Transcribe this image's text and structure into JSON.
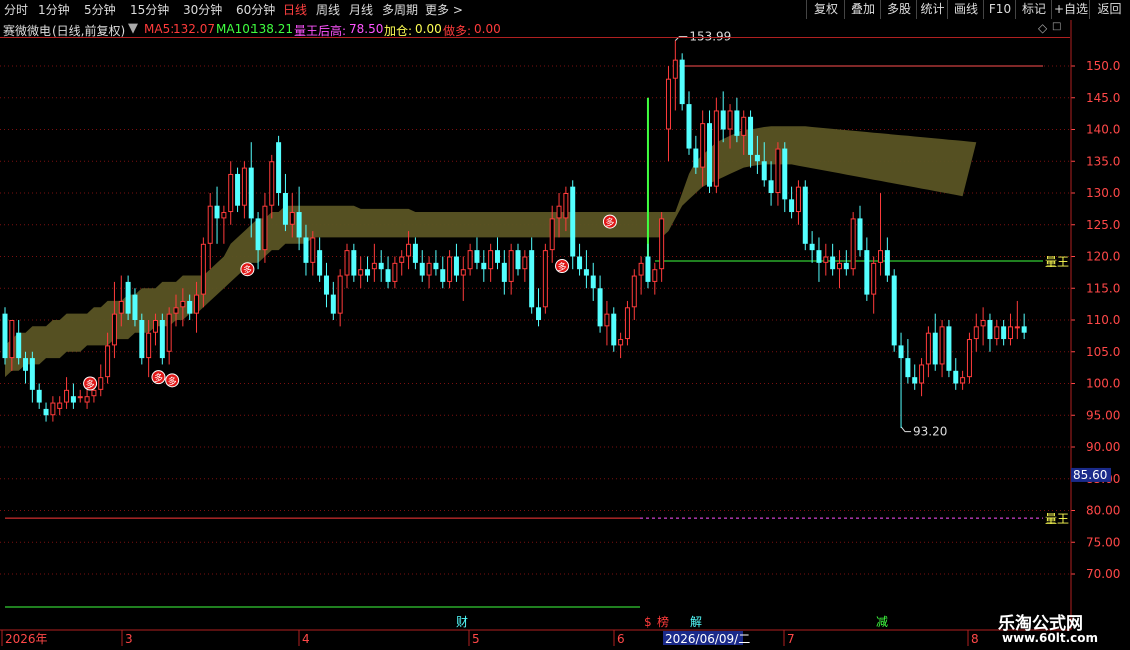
{
  "toolbar": {
    "periods": [
      "分时",
      "1分钟",
      "5分钟",
      "15分钟",
      "30分钟",
      "60分钟",
      "日线",
      "周线",
      "月线",
      "多周期",
      "更多 >"
    ],
    "active_period": "日线",
    "right_buttons": [
      "复权",
      "叠加",
      "多股",
      "统计",
      "画线",
      "F10",
      "标记",
      "+自选",
      "返回"
    ]
  },
  "info": {
    "stock_name": "赛微微电",
    "mode": "(日线,前复权)",
    "ma5_label": "MA5:",
    "ma5_value": "132.07",
    "ma10_label": "MA10:",
    "ma10_value": "138.21",
    "king_label": "量王后高:",
    "king_value": "78.50",
    "addpos_label": "加仓:",
    "addpos_value": "0.00",
    "short_label": "做多:",
    "short_value": "0.00"
  },
  "colors": {
    "up": "#ff3b3b",
    "down": "#54ffff",
    "band": "#5a5424",
    "grid": "#7a1010",
    "axis_text": "#ff4848",
    "yellow": "#ffff54",
    "magenta": "#ff54ff",
    "green": "#40ff40"
  },
  "price_axis": {
    "ticks": [
      150,
      145,
      140,
      135,
      130,
      125,
      120,
      115,
      110,
      105,
      100,
      95,
      90,
      85,
      80,
      75,
      70
    ],
    "tick_labels": [
      "150.0",
      "145.0",
      "140.0",
      "135.0",
      "130.0",
      "125.0",
      "120.0",
      "115.0",
      "110.0",
      "105.0",
      "100.0",
      "95.00",
      "90.00",
      "85.00",
      "80.00",
      "75.00",
      "70.00"
    ],
    "current_price_label": "85.60",
    "current_price": 85.6
  },
  "annotations": {
    "high_label": "153.99",
    "high_value": 153.99,
    "low_label": "93.20",
    "low_value": 93.2,
    "king_line_label_1": "量王",
    "king_line_value_1": 119.3,
    "king_line_label_2": "量王",
    "king_line_value_2": 78.8,
    "signal_label": "多"
  },
  "bottom_markers": [
    "财",
    "$",
    "榜",
    "解",
    "减"
  ],
  "date_axis": {
    "labels": [
      "2026年",
      "3",
      "4",
      "5",
      "6",
      "7",
      "8"
    ],
    "cursor_date": "2026/06/09/二"
  },
  "watermark": {
    "title": "乐淘公式网",
    "url": "www.60lt.com"
  },
  "chart_data": {
    "type": "candlestick",
    "ylim": [
      67,
      156
    ],
    "candles": [
      {
        "o": 111,
        "h": 112,
        "l": 103,
        "c": 104
      },
      {
        "o": 104,
        "h": 110,
        "l": 102,
        "c": 110
      },
      {
        "o": 108,
        "h": 110,
        "l": 103,
        "c": 104
      },
      {
        "o": 104,
        "h": 105,
        "l": 100,
        "c": 102
      },
      {
        "o": 104,
        "h": 105,
        "l": 97,
        "c": 99
      },
      {
        "o": 99,
        "h": 100,
        "l": 96,
        "c": 97
      },
      {
        "o": 96,
        "h": 97,
        "l": 94,
        "c": 95
      },
      {
        "o": 95,
        "h": 98,
        "l": 94,
        "c": 97
      },
      {
        "o": 96,
        "h": 98,
        "l": 95,
        "c": 97
      },
      {
        "o": 97,
        "h": 101,
        "l": 96,
        "c": 99
      },
      {
        "o": 98,
        "h": 100,
        "l": 96,
        "c": 97
      },
      {
        "o": 98,
        "h": 99,
        "l": 97,
        "c": 98
      },
      {
        "o": 97,
        "h": 99,
        "l": 96,
        "c": 98
      },
      {
        "o": 98,
        "h": 101,
        "l": 97,
        "c": 99
      },
      {
        "o": 99,
        "h": 103,
        "l": 98,
        "c": 101
      },
      {
        "o": 101,
        "h": 108,
        "l": 100,
        "c": 106
      },
      {
        "o": 106,
        "h": 116,
        "l": 104,
        "c": 111
      },
      {
        "o": 111,
        "h": 117,
        "l": 109,
        "c": 113
      },
      {
        "o": 116,
        "h": 117,
        "l": 110,
        "c": 111
      },
      {
        "o": 114,
        "h": 115,
        "l": 109,
        "c": 110
      },
      {
        "o": 110,
        "h": 111,
        "l": 103,
        "c": 104
      },
      {
        "o": 104,
        "h": 110,
        "l": 101,
        "c": 108
      },
      {
        "o": 108,
        "h": 111,
        "l": 106,
        "c": 110
      },
      {
        "o": 110,
        "h": 111,
        "l": 103,
        "c": 104
      },
      {
        "o": 105,
        "h": 112,
        "l": 103,
        "c": 111
      },
      {
        "o": 111,
        "h": 114,
        "l": 109,
        "c": 112
      },
      {
        "o": 112,
        "h": 115,
        "l": 109,
        "c": 113
      },
      {
        "o": 113,
        "h": 114,
        "l": 110,
        "c": 111
      },
      {
        "o": 111,
        "h": 116,
        "l": 108,
        "c": 114
      },
      {
        "o": 114,
        "h": 123,
        "l": 112,
        "c": 122
      },
      {
        "o": 122,
        "h": 130,
        "l": 118,
        "c": 128
      },
      {
        "o": 128,
        "h": 131,
        "l": 122,
        "c": 126
      },
      {
        "o": 126,
        "h": 128,
        "l": 122,
        "c": 127
      },
      {
        "o": 127,
        "h": 135,
        "l": 125,
        "c": 133
      },
      {
        "o": 133,
        "h": 134,
        "l": 127,
        "c": 128
      },
      {
        "o": 128,
        "h": 135,
        "l": 126,
        "c": 134
      },
      {
        "o": 134,
        "h": 138,
        "l": 123,
        "c": 126
      },
      {
        "o": 126,
        "h": 127,
        "l": 118,
        "c": 121
      },
      {
        "o": 121,
        "h": 130,
        "l": 119,
        "c": 128
      },
      {
        "o": 128,
        "h": 136,
        "l": 126,
        "c": 135
      },
      {
        "o": 138,
        "h": 139,
        "l": 128,
        "c": 130
      },
      {
        "o": 130,
        "h": 133,
        "l": 124,
        "c": 125
      },
      {
        "o": 125,
        "h": 130,
        "l": 123,
        "c": 127
      },
      {
        "o": 127,
        "h": 131,
        "l": 121,
        "c": 123
      },
      {
        "o": 123,
        "h": 125,
        "l": 117,
        "c": 119
      },
      {
        "o": 119,
        "h": 124,
        "l": 117,
        "c": 123
      },
      {
        "o": 121,
        "h": 123,
        "l": 116,
        "c": 117
      },
      {
        "o": 117,
        "h": 119,
        "l": 112,
        "c": 114
      },
      {
        "o": 114,
        "h": 116,
        "l": 110,
        "c": 111
      },
      {
        "o": 111,
        "h": 118,
        "l": 109,
        "c": 117
      },
      {
        "o": 117,
        "h": 122,
        "l": 115,
        "c": 121
      },
      {
        "o": 121,
        "h": 122,
        "l": 116,
        "c": 117
      },
      {
        "o": 117,
        "h": 120,
        "l": 115,
        "c": 118
      },
      {
        "o": 118,
        "h": 120,
        "l": 116,
        "c": 117
      },
      {
        "o": 118,
        "h": 122,
        "l": 116,
        "c": 119
      },
      {
        "o": 119,
        "h": 121,
        "l": 116,
        "c": 118
      },
      {
        "o": 118,
        "h": 120,
        "l": 115,
        "c": 116
      },
      {
        "o": 116,
        "h": 120,
        "l": 115,
        "c": 119
      },
      {
        "o": 119,
        "h": 121,
        "l": 117,
        "c": 120
      },
      {
        "o": 120,
        "h": 124,
        "l": 118,
        "c": 122
      },
      {
        "o": 122,
        "h": 123,
        "l": 118,
        "c": 119
      },
      {
        "o": 119,
        "h": 121,
        "l": 116,
        "c": 117
      },
      {
        "o": 117,
        "h": 120,
        "l": 115,
        "c": 119
      },
      {
        "o": 119,
        "h": 121,
        "l": 117,
        "c": 118
      },
      {
        "o": 118,
        "h": 120,
        "l": 115,
        "c": 116
      },
      {
        "o": 116,
        "h": 121,
        "l": 115,
        "c": 120
      },
      {
        "o": 120,
        "h": 122,
        "l": 116,
        "c": 117
      },
      {
        "o": 117,
        "h": 120,
        "l": 113,
        "c": 118
      },
      {
        "o": 118,
        "h": 122,
        "l": 117,
        "c": 121
      },
      {
        "o": 121,
        "h": 123,
        "l": 118,
        "c": 119
      },
      {
        "o": 119,
        "h": 121,
        "l": 116,
        "c": 118
      },
      {
        "o": 118,
        "h": 122,
        "l": 116,
        "c": 121
      },
      {
        "o": 121,
        "h": 123,
        "l": 118,
        "c": 119
      },
      {
        "o": 119,
        "h": 121,
        "l": 114,
        "c": 116
      },
      {
        "o": 116,
        "h": 122,
        "l": 114,
        "c": 121
      },
      {
        "o": 121,
        "h": 122,
        "l": 117,
        "c": 118
      },
      {
        "o": 118,
        "h": 121,
        "l": 116,
        "c": 120
      },
      {
        "o": 121,
        "h": 123,
        "l": 111,
        "c": 112
      },
      {
        "o": 112,
        "h": 115,
        "l": 109,
        "c": 110
      },
      {
        "o": 112,
        "h": 122,
        "l": 111,
        "c": 121
      },
      {
        "o": 121,
        "h": 128,
        "l": 119,
        "c": 126
      },
      {
        "o": 126,
        "h": 130,
        "l": 123,
        "c": 128
      },
      {
        "o": 126,
        "h": 131,
        "l": 124,
        "c": 130
      },
      {
        "o": 131,
        "h": 132,
        "l": 118,
        "c": 120
      },
      {
        "o": 120,
        "h": 122,
        "l": 117,
        "c": 118
      },
      {
        "o": 118,
        "h": 121,
        "l": 115,
        "c": 117
      },
      {
        "o": 117,
        "h": 119,
        "l": 113,
        "c": 115
      },
      {
        "o": 115,
        "h": 117,
        "l": 108,
        "c": 109
      },
      {
        "o": 109,
        "h": 113,
        "l": 106,
        "c": 111
      },
      {
        "o": 111,
        "h": 112,
        "l": 105,
        "c": 106
      },
      {
        "o": 106,
        "h": 108,
        "l": 104,
        "c": 107
      },
      {
        "o": 107,
        "h": 113,
        "l": 106,
        "c": 112
      },
      {
        "o": 112,
        "h": 118,
        "l": 110,
        "c": 117
      },
      {
        "o": 117,
        "h": 120,
        "l": 114,
        "c": 119
      },
      {
        "o": 120,
        "h": 122,
        "l": 115,
        "c": 116
      },
      {
        "o": 116,
        "h": 119,
        "l": 114,
        "c": 118
      },
      {
        "o": 118,
        "h": 127,
        "l": 116,
        "c": 126
      },
      {
        "o": 140,
        "h": 150,
        "l": 135,
        "c": 148
      },
      {
        "o": 148,
        "h": 154,
        "l": 143,
        "c": 151
      },
      {
        "o": 151,
        "h": 152,
        "l": 143,
        "c": 144
      },
      {
        "o": 144,
        "h": 146,
        "l": 136,
        "c": 137
      },
      {
        "o": 137,
        "h": 139,
        "l": 133,
        "c": 134
      },
      {
        "o": 134,
        "h": 143,
        "l": 131,
        "c": 141
      },
      {
        "o": 141,
        "h": 143,
        "l": 130,
        "c": 131
      },
      {
        "o": 131,
        "h": 145,
        "l": 130,
        "c": 143
      },
      {
        "o": 143,
        "h": 146,
        "l": 138,
        "c": 140
      },
      {
        "o": 140,
        "h": 144,
        "l": 137,
        "c": 143
      },
      {
        "o": 143,
        "h": 145,
        "l": 138,
        "c": 139
      },
      {
        "o": 139,
        "h": 143,
        "l": 136,
        "c": 142
      },
      {
        "o": 142,
        "h": 143,
        "l": 134,
        "c": 136
      },
      {
        "o": 136,
        "h": 139,
        "l": 133,
        "c": 135
      },
      {
        "o": 135,
        "h": 138,
        "l": 131,
        "c": 132
      },
      {
        "o": 132,
        "h": 135,
        "l": 128,
        "c": 130
      },
      {
        "o": 130,
        "h": 138,
        "l": 128,
        "c": 137
      },
      {
        "o": 137,
        "h": 138,
        "l": 127,
        "c": 129
      },
      {
        "o": 129,
        "h": 131,
        "l": 126,
        "c": 127
      },
      {
        "o": 127,
        "h": 132,
        "l": 125,
        "c": 131
      },
      {
        "o": 131,
        "h": 132,
        "l": 121,
        "c": 122
      },
      {
        "o": 122,
        "h": 124,
        "l": 119,
        "c": 121
      },
      {
        "o": 121,
        "h": 123,
        "l": 116,
        "c": 119
      },
      {
        "o": 119,
        "h": 122,
        "l": 117,
        "c": 120
      },
      {
        "o": 120,
        "h": 122,
        "l": 117,
        "c": 118
      },
      {
        "o": 118,
        "h": 121,
        "l": 115,
        "c": 119
      },
      {
        "o": 119,
        "h": 121,
        "l": 117,
        "c": 118
      },
      {
        "o": 118,
        "h": 127,
        "l": 117,
        "c": 126
      },
      {
        "o": 126,
        "h": 128,
        "l": 120,
        "c": 121
      },
      {
        "o": 121,
        "h": 123,
        "l": 113,
        "c": 114
      },
      {
        "o": 114,
        "h": 120,
        "l": 111,
        "c": 119
      },
      {
        "o": 119,
        "h": 130,
        "l": 117,
        "c": 121
      },
      {
        "o": 121,
        "h": 123,
        "l": 116,
        "c": 117
      },
      {
        "o": 117,
        "h": 118,
        "l": 105,
        "c": 106
      },
      {
        "o": 106,
        "h": 108,
        "l": 93,
        "c": 104
      },
      {
        "o": 104,
        "h": 107,
        "l": 100,
        "c": 101
      },
      {
        "o": 101,
        "h": 103,
        "l": 99,
        "c": 100
      },
      {
        "o": 100,
        "h": 104,
        "l": 98,
        "c": 103
      },
      {
        "o": 103,
        "h": 109,
        "l": 101,
        "c": 108
      },
      {
        "o": 108,
        "h": 111,
        "l": 102,
        "c": 103
      },
      {
        "o": 103,
        "h": 110,
        "l": 101,
        "c": 109
      },
      {
        "o": 109,
        "h": 110,
        "l": 101,
        "c": 102
      },
      {
        "o": 102,
        "h": 104,
        "l": 99,
        "c": 100
      },
      {
        "o": 100,
        "h": 102,
        "l": 99,
        "c": 101
      },
      {
        "o": 101,
        "h": 108,
        "l": 100,
        "c": 107
      },
      {
        "o": 107,
        "h": 111,
        "l": 105,
        "c": 109
      },
      {
        "o": 109,
        "h": 112,
        "l": 106,
        "c": 110
      },
      {
        "o": 110,
        "h": 111,
        "l": 105,
        "c": 107
      },
      {
        "o": 107,
        "h": 110,
        "l": 106,
        "c": 109
      },
      {
        "o": 109,
        "h": 110,
        "l": 106,
        "c": 107
      },
      {
        "o": 107,
        "h": 111,
        "l": 106,
        "c": 109
      },
      {
        "o": 109,
        "h": 113,
        "l": 107,
        "c": 109
      },
      {
        "o": 109,
        "h": 111,
        "l": 107,
        "c": 108
      }
    ],
    "band_upper": [
      106,
      107,
      108,
      108,
      109,
      109,
      109,
      110,
      110,
      111,
      111,
      111,
      111,
      112,
      112,
      113,
      113,
      113,
      114,
      114,
      115,
      115,
      115,
      116,
      116,
      116,
      117,
      117,
      117,
      117,
      118,
      119,
      120,
      122,
      123,
      124,
      125,
      126,
      126,
      127,
      127,
      128,
      128,
      128,
      128,
      128,
      128,
      128,
      128,
      128,
      128,
      128,
      127.5,
      127.5,
      127.5,
      127.5,
      127.5,
      127.5,
      127.5,
      127.5,
      127,
      127,
      127,
      127,
      127,
      127,
      127,
      127,
      127,
      127,
      127,
      127,
      127,
      127,
      127,
      127,
      127,
      127,
      127,
      127,
      127,
      127,
      127,
      127,
      127,
      127,
      127,
      127,
      127,
      127,
      127,
      127,
      127,
      127,
      127,
      127,
      127,
      127,
      127,
      130,
      133,
      135,
      136,
      137,
      138,
      138.5,
      139,
      139.5,
      140,
      140,
      140.2,
      140.4,
      140.5,
      140.5,
      140.5,
      140.5,
      140.5,
      140.5,
      140.4,
      140.3,
      140.2,
      140.1,
      140,
      139.9,
      139.8,
      139.7,
      139.6,
      139.5,
      139.4,
      139.3,
      139.2,
      139.1,
      139,
      138.9,
      138.8,
      138.7,
      138.6,
      138.5,
      138.4,
      138.3,
      138.2,
      138.1,
      138
    ],
    "band_lower": [
      101,
      102,
      102,
      103,
      103,
      103,
      104,
      104,
      104,
      105,
      105,
      105,
      106,
      106,
      106,
      106,
      107,
      107,
      107,
      108,
      108,
      108,
      109,
      109,
      109,
      110,
      110,
      111,
      111,
      112,
      113,
      114,
      115,
      116,
      117,
      118,
      119,
      119,
      120,
      121,
      121,
      122,
      122,
      122,
      122,
      123,
      123,
      123,
      123,
      123,
      123,
      123,
      123,
      123,
      123,
      123,
      123,
      123,
      123,
      123,
      123,
      123,
      123,
      123,
      123,
      123,
      123,
      123,
      123,
      123,
      123,
      123,
      123,
      123,
      123,
      123,
      123,
      123,
      123,
      123,
      123,
      123,
      123,
      123,
      123,
      123,
      123,
      123,
      123,
      123,
      123,
      123,
      123,
      123,
      123,
      123,
      123,
      124,
      126,
      128,
      129,
      130,
      131,
      131.5,
      132,
      132.5,
      133,
      133.5,
      134,
      134.2,
      134.4,
      134.5,
      134.5,
      134.5,
      134.5,
      134.5,
      134.3,
      134.1,
      133.9,
      133.7,
      133.5,
      133.3,
      133.1,
      132.9,
      132.7,
      132.5,
      132.3,
      132.1,
      131.9,
      131.7,
      131.5,
      131.3,
      131.1,
      130.9,
      130.7,
      130.5,
      130.3,
      130.1,
      129.9,
      129.7,
      129.5
    ],
    "signals": [
      {
        "index": 12,
        "price": 100
      },
      {
        "index": 22,
        "price": 101
      },
      {
        "index": 24,
        "price": 100.5
      },
      {
        "index": 35,
        "price": 118
      },
      {
        "index": 81,
        "price": 118.5
      },
      {
        "index": 88,
        "price": 125.5
      }
    ]
  }
}
